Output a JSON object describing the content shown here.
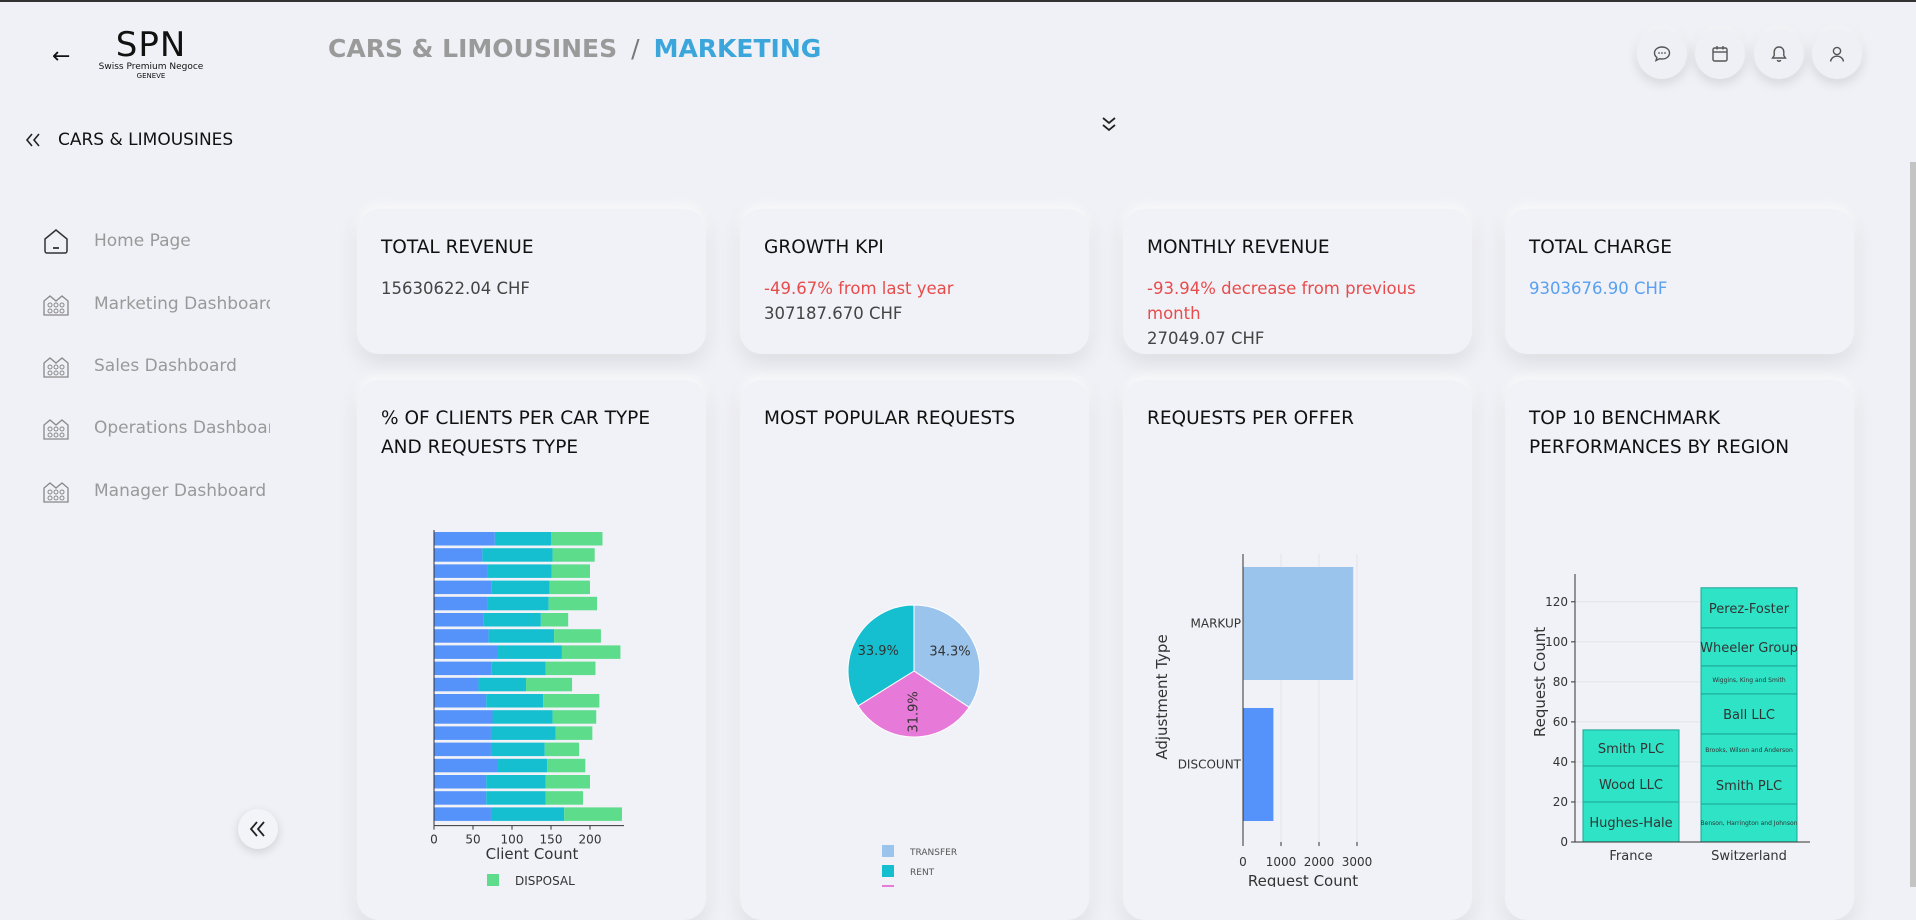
{
  "header": {
    "logo": {
      "mark": "SPN",
      "subtitle": "Swiss Premium Negoce",
      "city": "GENEVE"
    },
    "breadcrumb": {
      "section": "CARS & LIMOUSINES",
      "separator": "/",
      "page": "MARKETING"
    },
    "buttons": [
      {
        "name": "chat-icon"
      },
      {
        "name": "calendar-icon"
      },
      {
        "name": "bell-icon"
      },
      {
        "name": "user-icon"
      }
    ]
  },
  "sidebar": {
    "title": "CARS & LIMOUSINES",
    "items": [
      {
        "label": "Home Page",
        "icon": "home-icon"
      },
      {
        "label": "Marketing Dashboard",
        "icon": "building-icon"
      },
      {
        "label": "Sales Dashboard",
        "icon": "building-icon"
      },
      {
        "label": "Operations Dashboard",
        "icon": "building-icon"
      },
      {
        "label": "Manager Dashboard",
        "icon": "building-icon"
      }
    ]
  },
  "kpis": {
    "total_revenue": {
      "title": "TOTAL REVENUE",
      "value": "15630622.04 CHF"
    },
    "growth": {
      "title": "GROWTH KPI",
      "change": "-49.67% from last year",
      "value": "307187.670 CHF"
    },
    "monthly": {
      "title": "MONTHLY REVENUE",
      "change": "-93.94% decrease from previous month",
      "value": "27049.07 CHF"
    },
    "charge": {
      "title": "TOTAL CHARGE",
      "value": "9303676.90 CHF"
    }
  },
  "charts": {
    "clients": {
      "title": "% OF CLIENTS PER CAR TYPE AND REQUESTS TYPE"
    },
    "popular": {
      "title": "MOST POPULAR REQUESTS"
    },
    "offer": {
      "title": "REQUESTS PER OFFER"
    },
    "benchmark": {
      "title": "TOP 10 BENCHMARK PERFORMANCES BY REGION"
    }
  },
  "colors": {
    "blue": "#5592fa",
    "teal": "#16bfd0",
    "green": "#5ddc8c",
    "light_blue": "#9ac4ec",
    "pink": "#e77ad8",
    "turquoise": "#2ee3c6",
    "accent": "#3aa6dc"
  },
  "chart_data": [
    {
      "type": "bar",
      "orientation": "horizontal",
      "stacked": true,
      "xlabel": "Client Count",
      "xticks": [
        "0",
        "50",
        "100",
        "150",
        "200"
      ],
      "xlim": [
        0,
        240
      ],
      "legend": [
        "DISPOSAL"
      ],
      "series": [
        {
          "name": "",
          "color": "#5592fa",
          "values": [
            78,
            62,
            68,
            74,
            68,
            63,
            70,
            82,
            74,
            57,
            67,
            75,
            73,
            73,
            82,
            67,
            67,
            73
          ]
        },
        {
          "name": "",
          "color": "#16bfd0",
          "values": [
            72,
            90,
            83,
            74,
            79,
            74,
            84,
            82,
            69,
            61,
            73,
            77,
            83,
            69,
            63,
            76,
            76,
            94
          ]
        },
        {
          "name": "DISPOSAL",
          "color": "#5ddc8c",
          "values": [
            66,
            54,
            49,
            52,
            62,
            35,
            60,
            75,
            64,
            59,
            72,
            56,
            47,
            44,
            49,
            57,
            48,
            74
          ]
        }
      ]
    },
    {
      "type": "pie",
      "slices": [
        {
          "label": "TRANSFER",
          "value": 34.3,
          "text": "34.3%",
          "color": "#9ac4ec"
        },
        {
          "label": "",
          "value": 31.9,
          "text": "31.9%",
          "color": "#e77ad8"
        },
        {
          "label": "RENT",
          "value": 33.9,
          "text": "33.9%",
          "color": "#16bfd0"
        }
      ],
      "legend": [
        "TRANSFER",
        "RENT"
      ]
    },
    {
      "type": "bar",
      "orientation": "horizontal",
      "categories": [
        "MARKUP",
        "DISCOUNT"
      ],
      "values": [
        2900,
        800
      ],
      "colors": [
        "#9ac4ec",
        "#5592fa"
      ],
      "xlabel": "Request Count",
      "ylabel": "Adjustment Type",
      "xticks": [
        "0",
        "1000",
        "2000",
        "3000"
      ],
      "xlim": [
        0,
        3000
      ]
    },
    {
      "type": "bar",
      "stacked": true,
      "categories": [
        "France",
        "Switzerland"
      ],
      "ylabel": "Request Count",
      "ylim": [
        0,
        122
      ],
      "yticks": [
        "0",
        "20",
        "40",
        "60",
        "80",
        "100",
        "120"
      ],
      "stacks": [
        {
          "category": "France",
          "segments": [
            {
              "label": "Hughes-Hale",
              "value": 20
            },
            {
              "label": "Wood LLC",
              "value": 18
            },
            {
              "label": "Smith PLC",
              "value": 18
            }
          ]
        },
        {
          "category": "Switzerland",
          "segments": [
            {
              "label": "Benson, Harrington and Johnson",
              "value": 19
            },
            {
              "label": "Smith PLC",
              "value": 19
            },
            {
              "label": "Brooks, Wilson and Anderson",
              "value": 16
            },
            {
              "label": "Ball LLC",
              "value": 20
            },
            {
              "label": "Wiggins, King and Smith",
              "value": 14
            },
            {
              "label": "Wheeler Group",
              "value": 19
            },
            {
              "label": "Perez-Foster",
              "value": 20
            }
          ]
        }
      ]
    }
  ]
}
